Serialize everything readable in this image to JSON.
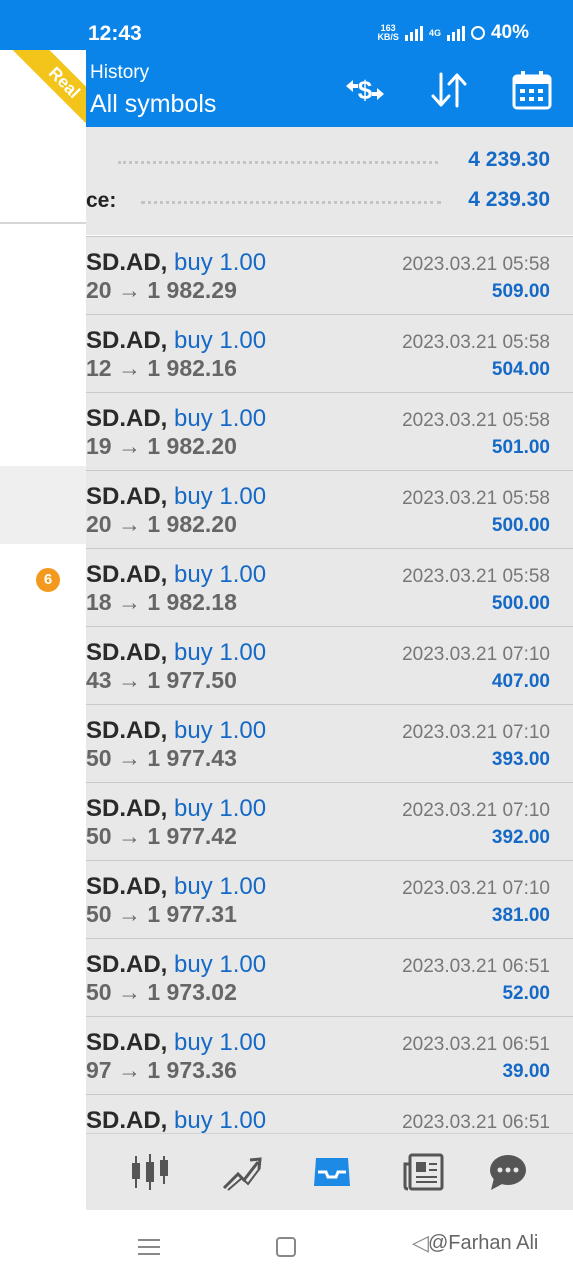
{
  "status": {
    "time": "12:43",
    "net_speed_value": "163",
    "net_speed_unit": "KB/S",
    "network_type": "4G",
    "battery": "40%"
  },
  "header": {
    "subtitle": "History",
    "title": "All symbols",
    "icons": [
      "currency-exchange-icon",
      "sort-icon",
      "calendar-icon"
    ]
  },
  "drawer": {
    "account_ribbon": "Real",
    "badge_count": "6"
  },
  "summary": {
    "row1_value": "4 239.30",
    "row2_label": "ce:",
    "row2_value": "4 239.30"
  },
  "trades": [
    {
      "symbol": "SD.AD,",
      "action": "buy 1.00",
      "prices": "20 → 1 982.29",
      "datetime": "2023.03.21 05:58",
      "profit": "509.00"
    },
    {
      "symbol": "SD.AD,",
      "action": "buy 1.00",
      "prices": "12 → 1 982.16",
      "datetime": "2023.03.21 05:58",
      "profit": "504.00"
    },
    {
      "symbol": "SD.AD,",
      "action": "buy 1.00",
      "prices": "19 → 1 982.20",
      "datetime": "2023.03.21 05:58",
      "profit": "501.00"
    },
    {
      "symbol": "SD.AD,",
      "action": "buy 1.00",
      "prices": "20 → 1 982.20",
      "datetime": "2023.03.21 05:58",
      "profit": "500.00"
    },
    {
      "symbol": "SD.AD,",
      "action": "buy 1.00",
      "prices": "18 → 1 982.18",
      "datetime": "2023.03.21 05:58",
      "profit": "500.00"
    },
    {
      "symbol": "SD.AD,",
      "action": "buy 1.00",
      "prices": "43 → 1 977.50",
      "datetime": "2023.03.21 07:10",
      "profit": "407.00"
    },
    {
      "symbol": "SD.AD,",
      "action": "buy 1.00",
      "prices": "50 → 1 977.43",
      "datetime": "2023.03.21 07:10",
      "profit": "393.00"
    },
    {
      "symbol": "SD.AD,",
      "action": "buy 1.00",
      "prices": "50 → 1 977.42",
      "datetime": "2023.03.21 07:10",
      "profit": "392.00"
    },
    {
      "symbol": "SD.AD,",
      "action": "buy 1.00",
      "prices": "50 → 1 977.31",
      "datetime": "2023.03.21 07:10",
      "profit": "381.00"
    },
    {
      "symbol": "SD.AD,",
      "action": "buy 1.00",
      "prices": "50 → 1 973.02",
      "datetime": "2023.03.21 06:51",
      "profit": "52.00"
    },
    {
      "symbol": "SD.AD,",
      "action": "buy 1.00",
      "prices": "97 → 1 973.36",
      "datetime": "2023.03.21 06:51",
      "profit": "39.00"
    },
    {
      "symbol": "SD.AD,",
      "action": "buy 1.00",
      "prices": "",
      "datetime": "2023.03.21 06:51",
      "profit": ""
    }
  ],
  "tabbar": {
    "tabs": [
      "quotes-candlestick-icon",
      "chart-trend-icon",
      "history-inbox-icon",
      "news-icon",
      "chat-icon"
    ],
    "active_tab": "history-inbox-icon"
  },
  "watermark": "@Farhan Ali",
  "colors": {
    "primary": "#0a84e8",
    "value_blue": "#1569c7",
    "ribbon": "#f3c51b",
    "badge": "#f39a1e",
    "list_bg": "#e8e8e8"
  }
}
